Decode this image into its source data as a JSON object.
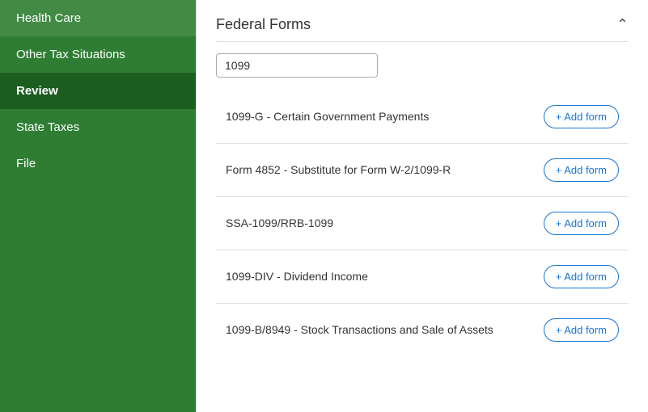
{
  "sidebar": {
    "items": [
      {
        "id": "health-care",
        "label": "Health Care",
        "active": false
      },
      {
        "id": "other-tax",
        "label": "Other Tax Situations",
        "active": false
      },
      {
        "id": "review",
        "label": "Review",
        "active": true
      },
      {
        "id": "state-taxes",
        "label": "State Taxes",
        "active": false
      },
      {
        "id": "file",
        "label": "File",
        "active": false
      }
    ]
  },
  "main": {
    "section_title": "Federal Forms",
    "search_placeholder": "1099",
    "search_value": "1099",
    "forms": [
      {
        "id": "1099-g",
        "label": "1099-G - Certain Government Payments",
        "btn": "+ Add form"
      },
      {
        "id": "4852",
        "label": "Form 4852 - Substitute for Form W-2/1099-R",
        "btn": "+ Add form"
      },
      {
        "id": "ssa-1099",
        "label": "SSA-1099/RRB-1099",
        "btn": "+ Add form"
      },
      {
        "id": "1099-div",
        "label": "1099-DIV - Dividend Income",
        "btn": "+ Add form"
      },
      {
        "id": "1099-b",
        "label": "1099-B/8949 - Stock Transactions and Sale of Assets",
        "btn": "+ Add form"
      }
    ],
    "chevron": "⌃"
  }
}
